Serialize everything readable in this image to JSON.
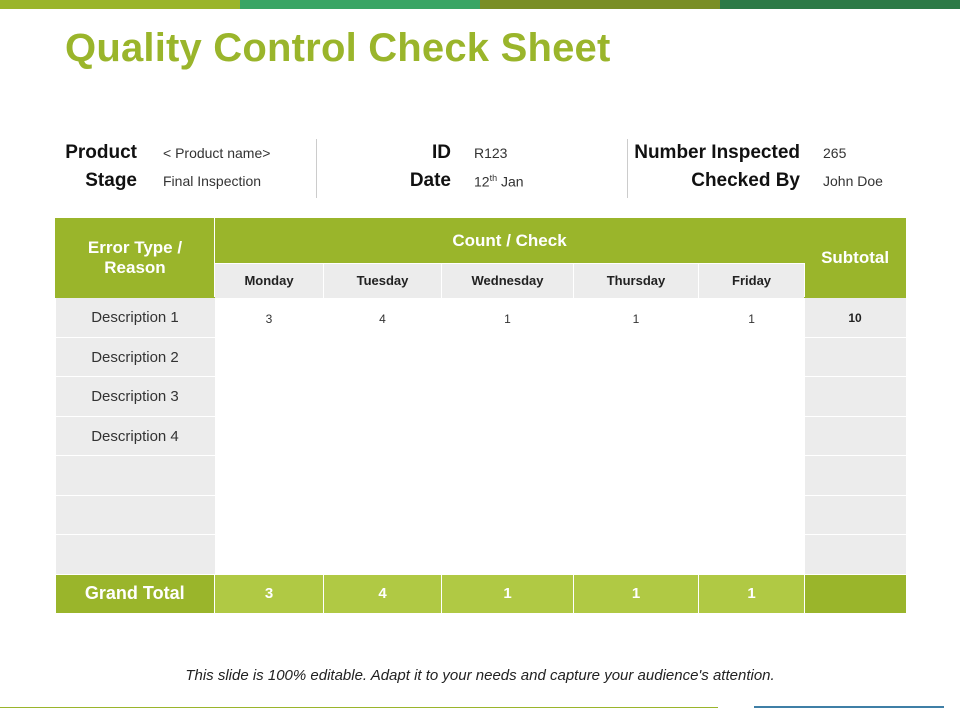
{
  "colors": {
    "topbar": [
      "#9ab52b",
      "#3aa565",
      "#7a8e25",
      "#2d7a47"
    ],
    "accent": "#9ab52b",
    "accent_light": "#b0c944",
    "row_gray": "#ececec"
  },
  "title": "Quality Control Check Sheet",
  "info": {
    "product_label": "Product",
    "product_value": "< Product name>",
    "stage_label": "Stage",
    "stage_value": "Final Inspection",
    "id_label": "ID",
    "id_value": "R123",
    "date_label": "Date",
    "date_day": "12",
    "date_suffix": "th",
    "date_month": " Jan",
    "number_inspected_label": "Number Inspected",
    "number_inspected_value": "265",
    "checked_by_label": "Checked By",
    "checked_by_value": "John Doe"
  },
  "table": {
    "error_header": "Error Type / Reason",
    "count_header": "Count / Check",
    "subtotal_header": "Subtotal",
    "days": [
      "Monday",
      "Tuesday",
      "Wednesday",
      "Thursday",
      "Friday"
    ],
    "rows": [
      {
        "desc": "Description 1",
        "values": [
          "3",
          "4",
          "1",
          "1",
          "1"
        ],
        "subtotal": "10"
      },
      {
        "desc": "Description 2",
        "values": [
          "",
          "",
          "",
          "",
          ""
        ],
        "subtotal": ""
      },
      {
        "desc": "Description 3",
        "values": [
          "",
          "",
          "",
          "",
          ""
        ],
        "subtotal": ""
      },
      {
        "desc": "Description 4",
        "values": [
          "",
          "",
          "",
          "",
          ""
        ],
        "subtotal": ""
      },
      {
        "desc": "",
        "values": [
          "",
          "",
          "",
          "",
          ""
        ],
        "subtotal": ""
      },
      {
        "desc": "",
        "values": [
          "",
          "",
          "",
          "",
          ""
        ],
        "subtotal": ""
      },
      {
        "desc": "",
        "values": [
          "",
          "",
          "",
          "",
          ""
        ],
        "subtotal": ""
      }
    ],
    "grand_total_label": "Grand Total",
    "grand_totals": [
      "3",
      "4",
      "1",
      "1",
      "1"
    ],
    "grand_total_subtotal": ""
  },
  "footer": "This slide is 100% editable. Adapt it to your needs and capture your audience's attention."
}
